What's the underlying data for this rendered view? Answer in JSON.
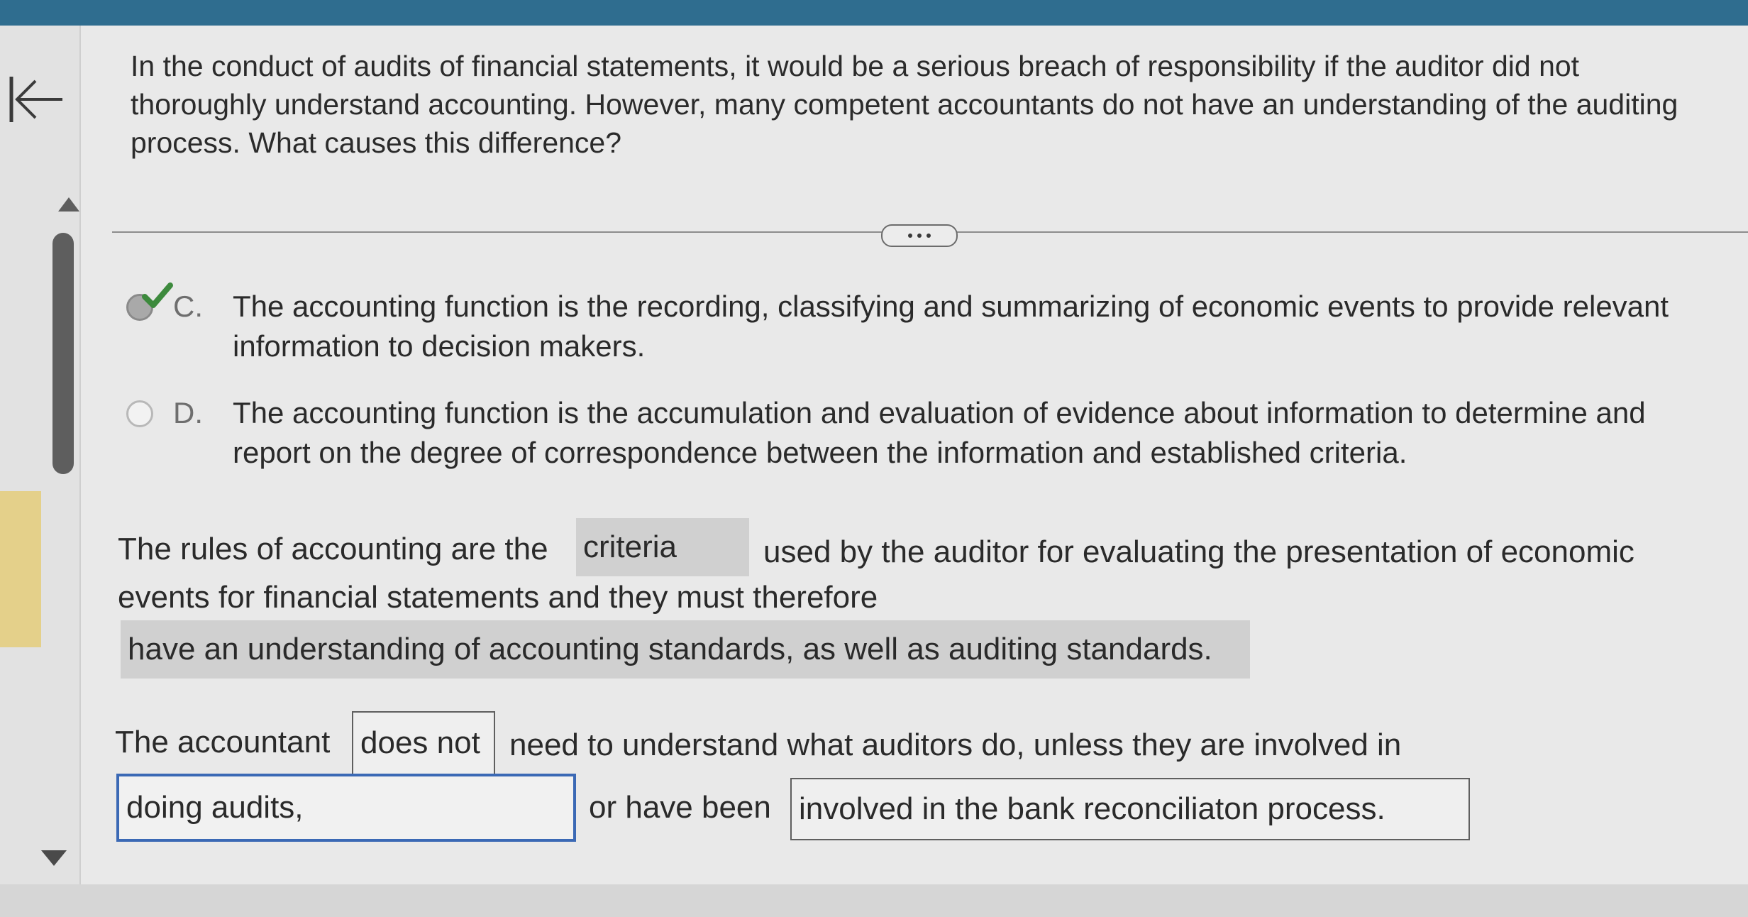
{
  "question": {
    "prompt": "In the conduct of audits of financial statements, it would be a serious breach of responsibility if the auditor did not thoroughly understand accounting. However, many competent accountants do not have an understanding of the auditing process. What causes this difference?"
  },
  "options": [
    {
      "letter": "C.",
      "text": "The accounting function is the recording, classifying and summarizing of economic events to provide relevant information to decision makers.",
      "selected": true,
      "icon": "checkmark-icon"
    },
    {
      "letter": "D.",
      "text": "The accounting function is the accumulation and evaluation of evidence about information to determine and report on the degree of correspondence between the information and established criteria.",
      "selected": false
    }
  ],
  "fill_in": {
    "sentence1_part1": "The rules of accounting are the",
    "answer1": "criteria",
    "sentence1_part2": "used by the auditor for evaluating the presentation of economic",
    "sentence1_part3": "events for financial statements and they must therefore",
    "answer2": "have an understanding of accounting standards, as well as auditing standards.",
    "sentence2_part1": "The accountant",
    "answer3": "does not",
    "sentence2_part2": "need to understand what auditors do, unless they are involved in",
    "answer4": "doing audits,",
    "sentence2_part3": "or have been",
    "answer5": "involved in the bank reconciliaton process."
  },
  "colors": {
    "topbar": "#2f6d8f",
    "focus_border": "#3b69b5",
    "answer_fill": "#d0d0d0",
    "check_green": "#3d8a3d"
  }
}
